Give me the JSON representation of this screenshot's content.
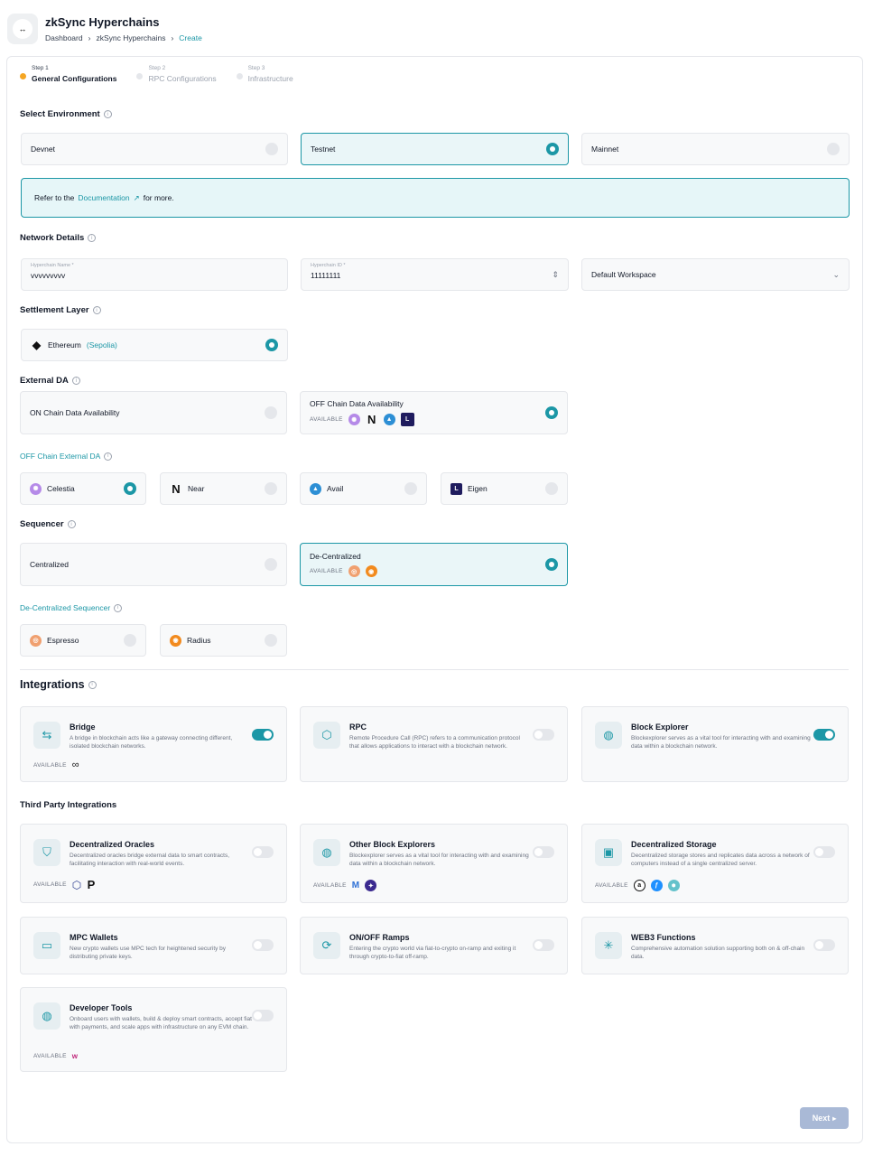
{
  "header": {
    "title": "zkSync Hyperchains",
    "logo_glyph": "↔",
    "breadcrumbs": [
      "Dashboard",
      "zkSync Hyperchains",
      "Create"
    ],
    "separator": "›"
  },
  "steps": [
    {
      "num": "Step 1",
      "label": "General Configurations",
      "active": true
    },
    {
      "num": "Step 2",
      "label": "RPC Configurations",
      "active": false
    },
    {
      "num": "Step 3",
      "label": "Infrastructure",
      "active": false
    }
  ],
  "environment": {
    "title": "Select Environment",
    "options": [
      {
        "label": "Devnet",
        "selected": false
      },
      {
        "label": "Testnet",
        "selected": true
      },
      {
        "label": "Mainnet",
        "selected": false
      }
    ],
    "banner_prefix": "Refer to the",
    "banner_link": "Documentation",
    "banner_suffix": "for more."
  },
  "network": {
    "title": "Network Details",
    "name_label": "Hyperchain Name *",
    "name_value": "vvvvvvvvv",
    "id_label": "Hyperchain ID *",
    "id_value": "11111111",
    "workspace": "Default Workspace"
  },
  "settlement": {
    "title": "Settlement Layer",
    "name": "Ethereum",
    "network": "(Sepolia)"
  },
  "external_da": {
    "title": "External DA",
    "on_chain": "ON Chain Data Availability",
    "off_chain": "OFF Chain Data Availability",
    "available": "AVAILABLE",
    "off_chain_title": "OFF Chain External DA",
    "providers": [
      {
        "label": "Celestia",
        "selected": true
      },
      {
        "label": "Near",
        "selected": false
      },
      {
        "label": "Avail",
        "selected": false
      },
      {
        "label": "Eigen",
        "selected": false
      }
    ]
  },
  "sequencer": {
    "title": "Sequencer",
    "centralized": "Centralized",
    "decentralized": "De-Centralized",
    "available": "AVAILABLE",
    "dec_title": "De-Centralized Sequencer",
    "providers": [
      "Espresso",
      "Radius"
    ]
  },
  "integrations": {
    "title": "Integrations",
    "items": [
      {
        "title": "Bridge",
        "desc": "A bridge in blockchain acts like a gateway connecting different, isolated blockchain networks.",
        "on": true,
        "available": "AVAILABLE"
      },
      {
        "title": "RPC",
        "desc": "Remote Procedure Call (RPC) refers to a communication protocol that allows applications to interact with a blockchain network.",
        "on": false
      },
      {
        "title": "Block Explorer",
        "desc": "Blockexplorer serves as a vital tool for interacting with and examining data within a blockchain network.",
        "on": true
      }
    ]
  },
  "third_party": {
    "title": "Third Party Integrations",
    "items": [
      {
        "title": "Decentralized Oracles",
        "desc": "Decentralized oracles bridge external data to smart contracts, facilitating interaction with real-world events.",
        "available": "AVAILABLE"
      },
      {
        "title": "Other Block Explorers",
        "desc": "Blockexplorer serves as a vital tool for interacting with and examining data within a blockchain network.",
        "available": "AVAILABLE"
      },
      {
        "title": "Decentralized Storage",
        "desc": "Decentralized storage stores and replicates data across a network of computers instead of a single centralized server.",
        "available": "AVAILABLE"
      },
      {
        "title": "MPC Wallets",
        "desc": "New crypto wallets use MPC tech for heightened security by distributing private keys."
      },
      {
        "title": "ON/OFF Ramps",
        "desc": "Entering the crypto world via fiat-to-crypto on-ramp and exiting it through crypto-to-fiat off-ramp."
      },
      {
        "title": "WEB3 Functions",
        "desc": "Comprehensive automation solution supporting both on & off-chain data."
      },
      {
        "title": "Developer Tools",
        "desc": "Onboard users with wallets, build & deploy smart contracts, accept fiat with payments, and scale apps with infrastructure on any EVM chain.",
        "available": "AVAILABLE"
      }
    ]
  },
  "footer": {
    "next": "Next"
  },
  "colors": {
    "accent": "#1c97a6",
    "step_active": "#f5a623",
    "next_disabled": "#a9b9d6"
  }
}
